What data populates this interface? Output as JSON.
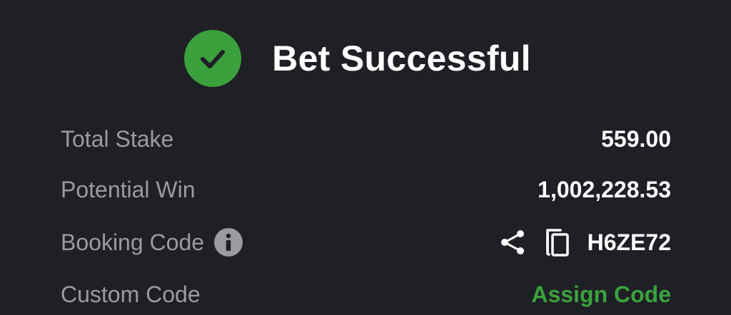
{
  "header": {
    "title": "Bet Successful",
    "icon": "check-circle-icon",
    "accent_color": "#3aa13d"
  },
  "summary": {
    "total_stake_label": "Total Stake",
    "total_stake_value": "559.00",
    "potential_win_label": "Potential Win",
    "potential_win_value": "1,002,228.53",
    "booking_code_label": "Booking Code",
    "booking_code_value": "H6ZE72",
    "custom_code_label": "Custom Code",
    "assign_code_label": "Assign Code"
  },
  "icons": {
    "info": "info-icon",
    "share": "share-icon",
    "copy": "copy-icon"
  },
  "colors": {
    "background": "#1f2025",
    "label_text": "#9a9ba1",
    "value_text": "#ffffff",
    "success_green": "#3aa13d"
  }
}
